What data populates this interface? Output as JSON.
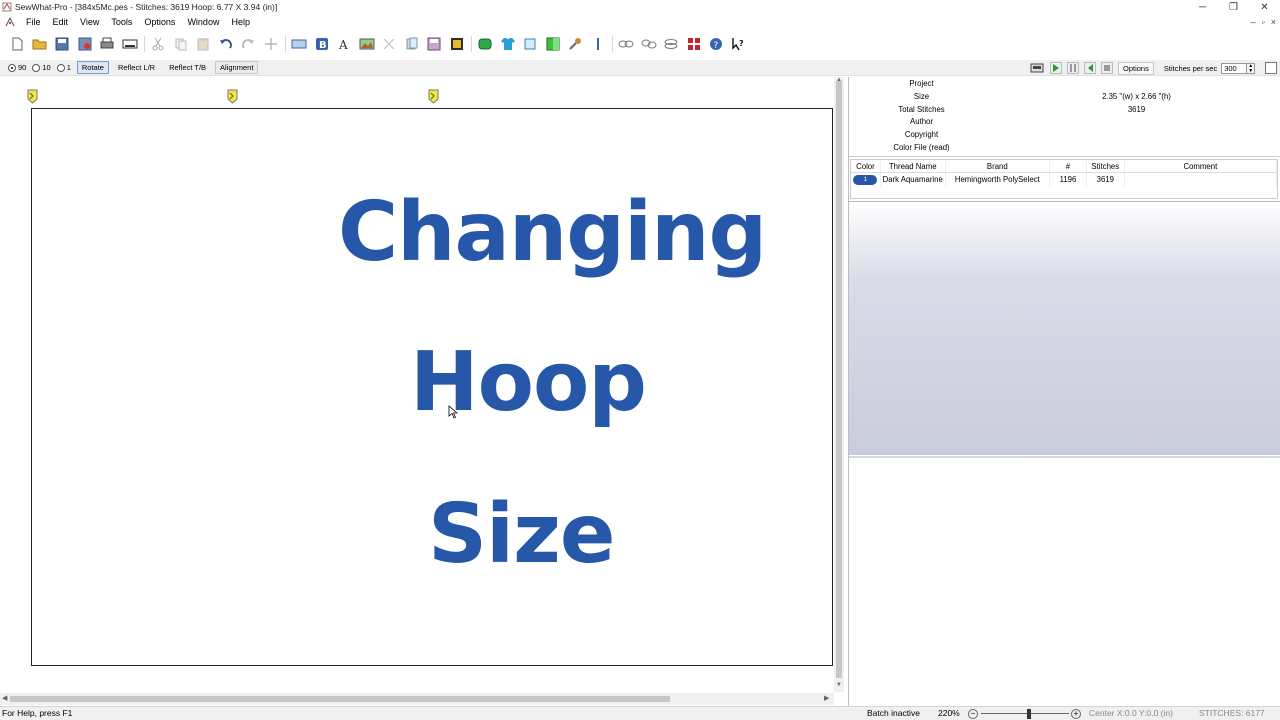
{
  "window": {
    "title": "SewWhat-Pro - [384x5Mc.pes - Stitches: 3619  Hoop: 6.77 X 3.94 (in)]",
    "minimize": "─",
    "restore": "❐",
    "close": "✕"
  },
  "menu": [
    "File",
    "Edit",
    "View",
    "Tools",
    "Options",
    "Window",
    "Help"
  ],
  "mdi": {
    "minimize": "–",
    "restore": "▫",
    "close": "×"
  },
  "toolbar2": {
    "radio_90": "90",
    "radio_10": "10",
    "radio_1": "1",
    "rotate": "Rotate",
    "reflect_lr": "Reflect L/R",
    "reflect_tb": "Reflect T/B",
    "alignment": "Alignment",
    "options": "Options",
    "stitches_per_sec_label": "Stitches per sec",
    "stitches_per_sec_value": "300"
  },
  "canvas": {
    "line1": "Changing",
    "line2": "Hoop",
    "line3": "Size"
  },
  "properties": [
    {
      "key": "Project",
      "value": ""
    },
    {
      "key": "Size",
      "value": "2.35 \"(w) x 2.66 \"(h)"
    },
    {
      "key": "Total Stitches",
      "value": "3619"
    },
    {
      "key": "Author",
      "value": ""
    },
    {
      "key": "Copyright",
      "value": ""
    },
    {
      "key": "Color File (read)",
      "value": ""
    }
  ],
  "thread_table": {
    "headers": [
      "Color",
      "Thread Name",
      "Brand",
      "#",
      "Stitches",
      "Comment"
    ],
    "rows": [
      {
        "color_index": "1",
        "thread_name": "Dark Aquamarine",
        "brand": "Hemingworth PolySelect",
        "number": "1196",
        "stitches": "3619",
        "comment": ""
      }
    ]
  },
  "status": {
    "help": "For Help, press F1",
    "batch": "Batch inactive",
    "zoom": "220%",
    "zoom_level": 0.55,
    "center": "Center X:0.0  Y:0.0 (in)",
    "stitches": "STITCHES:   6177"
  },
  "colors": {
    "thread": "#2657a8"
  }
}
